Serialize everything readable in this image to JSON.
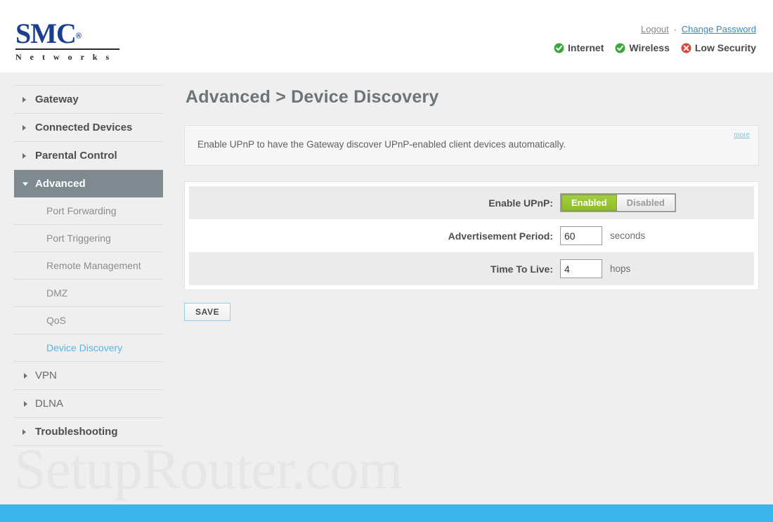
{
  "brand": {
    "name": "SMC",
    "trademark": "®",
    "subtitle": "N e t w o r k s"
  },
  "header": {
    "logout_label": "Logout",
    "separator": "·",
    "change_password_label": "Change Password",
    "statuses": [
      {
        "label": "Internet",
        "icon": "check-circle-icon",
        "color": "#3aa93a"
      },
      {
        "label": "Wireless",
        "icon": "check-circle-icon",
        "color": "#3aa93a"
      },
      {
        "label": "Low Security",
        "icon": "x-circle-icon",
        "color": "#d9443f"
      }
    ]
  },
  "sidebar": {
    "items": [
      {
        "label": "Gateway",
        "type": "top",
        "state": "collapsed"
      },
      {
        "label": "Connected Devices",
        "type": "top",
        "state": "collapsed"
      },
      {
        "label": "Parental Control",
        "type": "top",
        "state": "collapsed"
      },
      {
        "label": "Advanced",
        "type": "top",
        "state": "expanded"
      },
      {
        "label": "Port Forwarding",
        "type": "sub",
        "state": "normal"
      },
      {
        "label": "Port Triggering",
        "type": "sub",
        "state": "normal"
      },
      {
        "label": "Remote Management",
        "type": "sub",
        "state": "normal"
      },
      {
        "label": "DMZ",
        "type": "sub",
        "state": "normal"
      },
      {
        "label": "QoS",
        "type": "sub",
        "state": "normal"
      },
      {
        "label": "Device Discovery",
        "type": "sub",
        "state": "selected"
      },
      {
        "label": "VPN",
        "type": "sub-group",
        "state": "collapsed"
      },
      {
        "label": "DLNA",
        "type": "sub-group",
        "state": "collapsed"
      },
      {
        "label": "Troubleshooting",
        "type": "top",
        "state": "collapsed"
      }
    ]
  },
  "main": {
    "title": "Advanced > Device Discovery",
    "description": "Enable UPnP to have the Gateway discover UPnP-enabled client devices automatically.",
    "more_label": "more",
    "form": {
      "upnp": {
        "label": "Enable UPnP:",
        "enabled_label": "Enabled",
        "disabled_label": "Disabled",
        "selected": "Enabled"
      },
      "advertisement_period": {
        "label": "Advertisement Period:",
        "value": "60",
        "unit": "seconds"
      },
      "time_to_live": {
        "label": "Time To Live:",
        "value": "4",
        "unit": "hops"
      }
    },
    "save_label": "SAVE"
  },
  "watermark": {
    "text": "SetupRouter.com"
  },
  "colors": {
    "accent_green": "#8ebd28",
    "accent_blue": "#3bb4ea",
    "active_nav": "#7f8a90",
    "brand_navy": "#1b3f8f"
  }
}
